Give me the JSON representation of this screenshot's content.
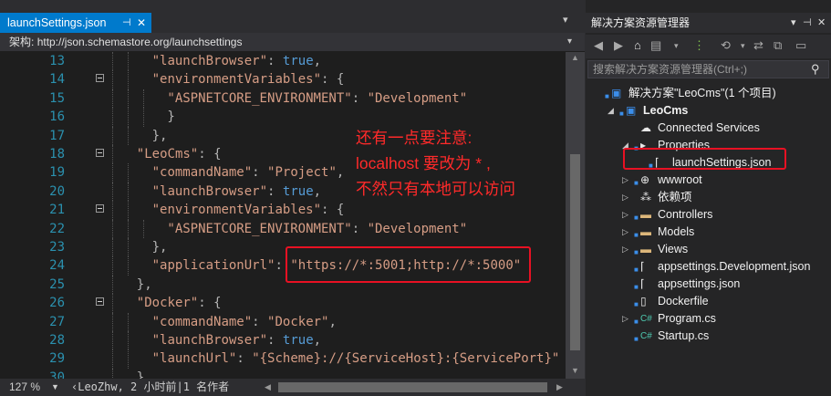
{
  "editor": {
    "tab": {
      "label": "launchSettings.json",
      "pin_icon": "pin-icon",
      "close_icon": "close-icon"
    },
    "schema": {
      "label": "架构:",
      "url": "http://json.schemastore.org/launchsettings"
    },
    "lines": [
      {
        "num": "13",
        "text": "\"launchBrowser\": true,"
      },
      {
        "num": "14",
        "text": "\"environmentVariables\": {"
      },
      {
        "num": "15",
        "text": "\"ASPNETCORE_ENVIRONMENT\": \"Development\""
      },
      {
        "num": "16",
        "text": "}"
      },
      {
        "num": "17",
        "text": "},"
      },
      {
        "num": "18",
        "text": "\"LeoCms\": {"
      },
      {
        "num": "19",
        "text": "\"commandName\": \"Project\","
      },
      {
        "num": "20",
        "text": "\"launchBrowser\": true,"
      },
      {
        "num": "21",
        "text": "\"environmentVariables\": {"
      },
      {
        "num": "22",
        "text": "\"ASPNETCORE_ENVIRONMENT\": \"Development\""
      },
      {
        "num": "23",
        "text": "},"
      },
      {
        "num": "24",
        "text": "\"applicationUrl\": \"https://*:5001;http://*:5000\""
      },
      {
        "num": "25",
        "text": "},"
      },
      {
        "num": "26",
        "text": "\"Docker\": {"
      },
      {
        "num": "27",
        "text": "\"commandName\": \"Docker\","
      },
      {
        "num": "28",
        "text": "\"launchBrowser\": true,"
      },
      {
        "num": "29",
        "text": "\"launchUrl\": \"{Scheme}://{ServiceHost}:{ServicePort}\""
      },
      {
        "num": "30",
        "text": "}"
      }
    ],
    "annotation": "还有一点要注意:\nlocalhost 要改为 * ,\n不然只有本地可以访问",
    "status": {
      "zoom": "127 %",
      "blame": "LeoZhw, 2 小时前|1 名作者"
    }
  },
  "explorer": {
    "title": "解决方案资源管理器",
    "search_placeholder": "搜索解决方案资源管理器(Ctrl+;)",
    "tree": [
      {
        "label": "解决方案\"LeoCms\"(1 个项目)",
        "icon": "solution-icon"
      },
      {
        "label": "LeoCms",
        "icon": "project-icon"
      },
      {
        "label": "Connected Services",
        "icon": "connected-services-icon"
      },
      {
        "label": "Properties",
        "icon": "properties-folder-icon"
      },
      {
        "label": "launchSettings.json",
        "icon": "json-file-icon"
      },
      {
        "label": "wwwroot",
        "icon": "globe-icon"
      },
      {
        "label": "依赖项",
        "icon": "dependencies-icon"
      },
      {
        "label": "Controllers",
        "icon": "folder-icon"
      },
      {
        "label": "Models",
        "icon": "folder-icon"
      },
      {
        "label": "Views",
        "icon": "folder-icon"
      },
      {
        "label": "appsettings.Development.json",
        "icon": "json-file-icon"
      },
      {
        "label": "appsettings.json",
        "icon": "json-file-icon"
      },
      {
        "label": "Dockerfile",
        "icon": "file-icon"
      },
      {
        "label": "Program.cs",
        "icon": "csharp-file-icon"
      },
      {
        "label": "Startup.cs",
        "icon": "csharp-file-icon"
      }
    ]
  },
  "colors": {
    "accent": "#007acc",
    "highlight": "#e81123",
    "annotation": "#ff2a2a"
  }
}
